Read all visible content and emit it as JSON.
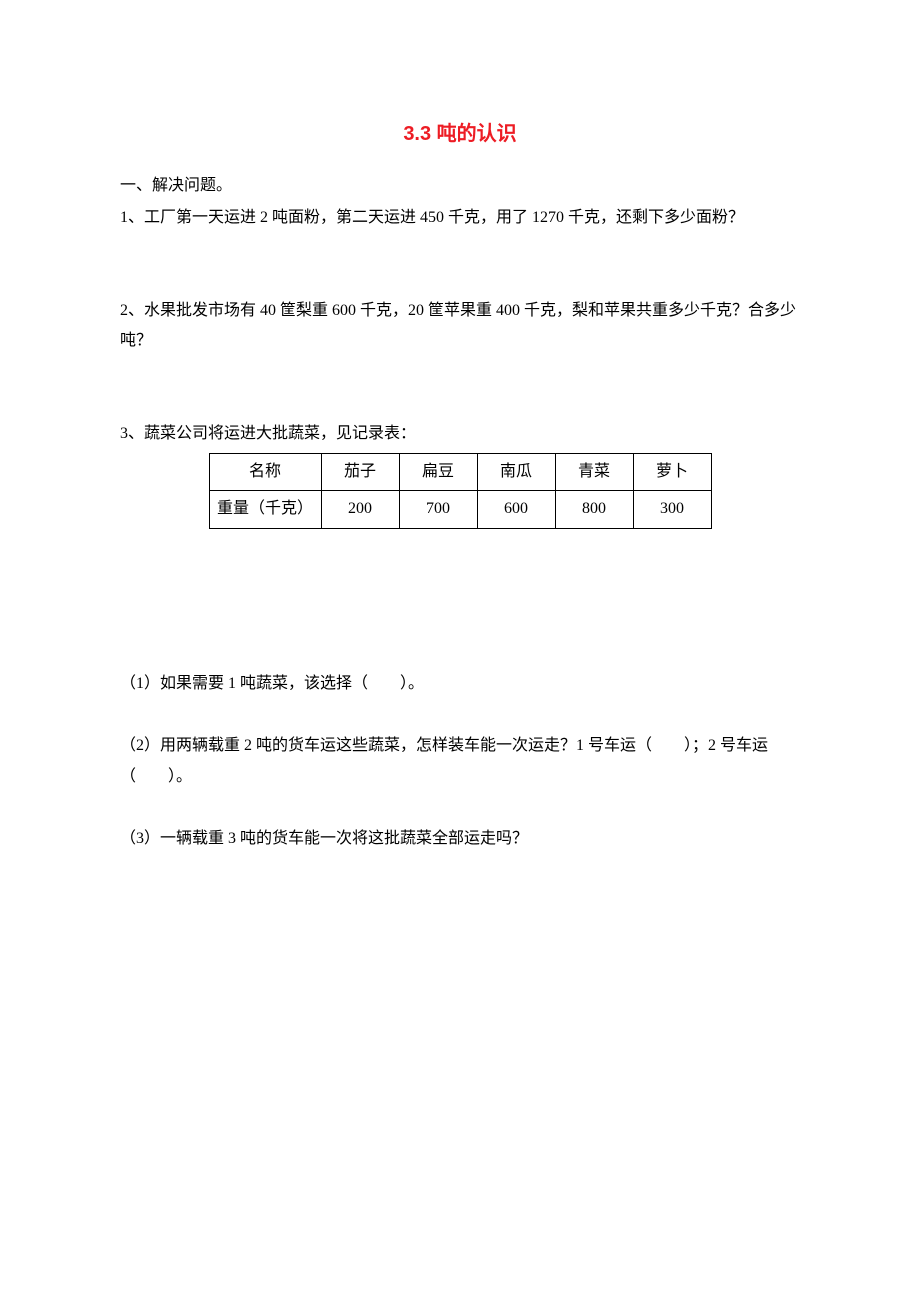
{
  "title": "3.3 吨的认识",
  "section1": {
    "heading": "一、解决问题。",
    "q1": "1、工厂第一天运进 2 吨面粉，第二天运进 450 千克，用了 1270 千克，还剩下多少面粉？",
    "q2": "2、水果批发市场有 40 筐梨重 600 千克，20 筐苹果重 400 千克，梨和苹果共重多少千克？合多少吨？",
    "q3_intro": "3、蔬菜公司将运进大批蔬菜，见记录表：",
    "q3_sub1": "（1）如果需要 1 吨蔬菜，该选择（　　）。",
    "q3_sub2": "（2）用两辆载重 2 吨的货车运这些蔬菜，怎样装车能一次运走？1 号车运（　　）；2 号车运（　　）。",
    "q3_sub3": "（3）一辆载重 3 吨的货车能一次将这批蔬菜全部运走吗？"
  },
  "chart_data": {
    "type": "table",
    "headers": [
      "名称",
      "茄子",
      "扁豆",
      "南瓜",
      "青菜",
      "萝卜"
    ],
    "row_label": "重量（千克）",
    "values": [
      200,
      700,
      600,
      800,
      300
    ]
  }
}
